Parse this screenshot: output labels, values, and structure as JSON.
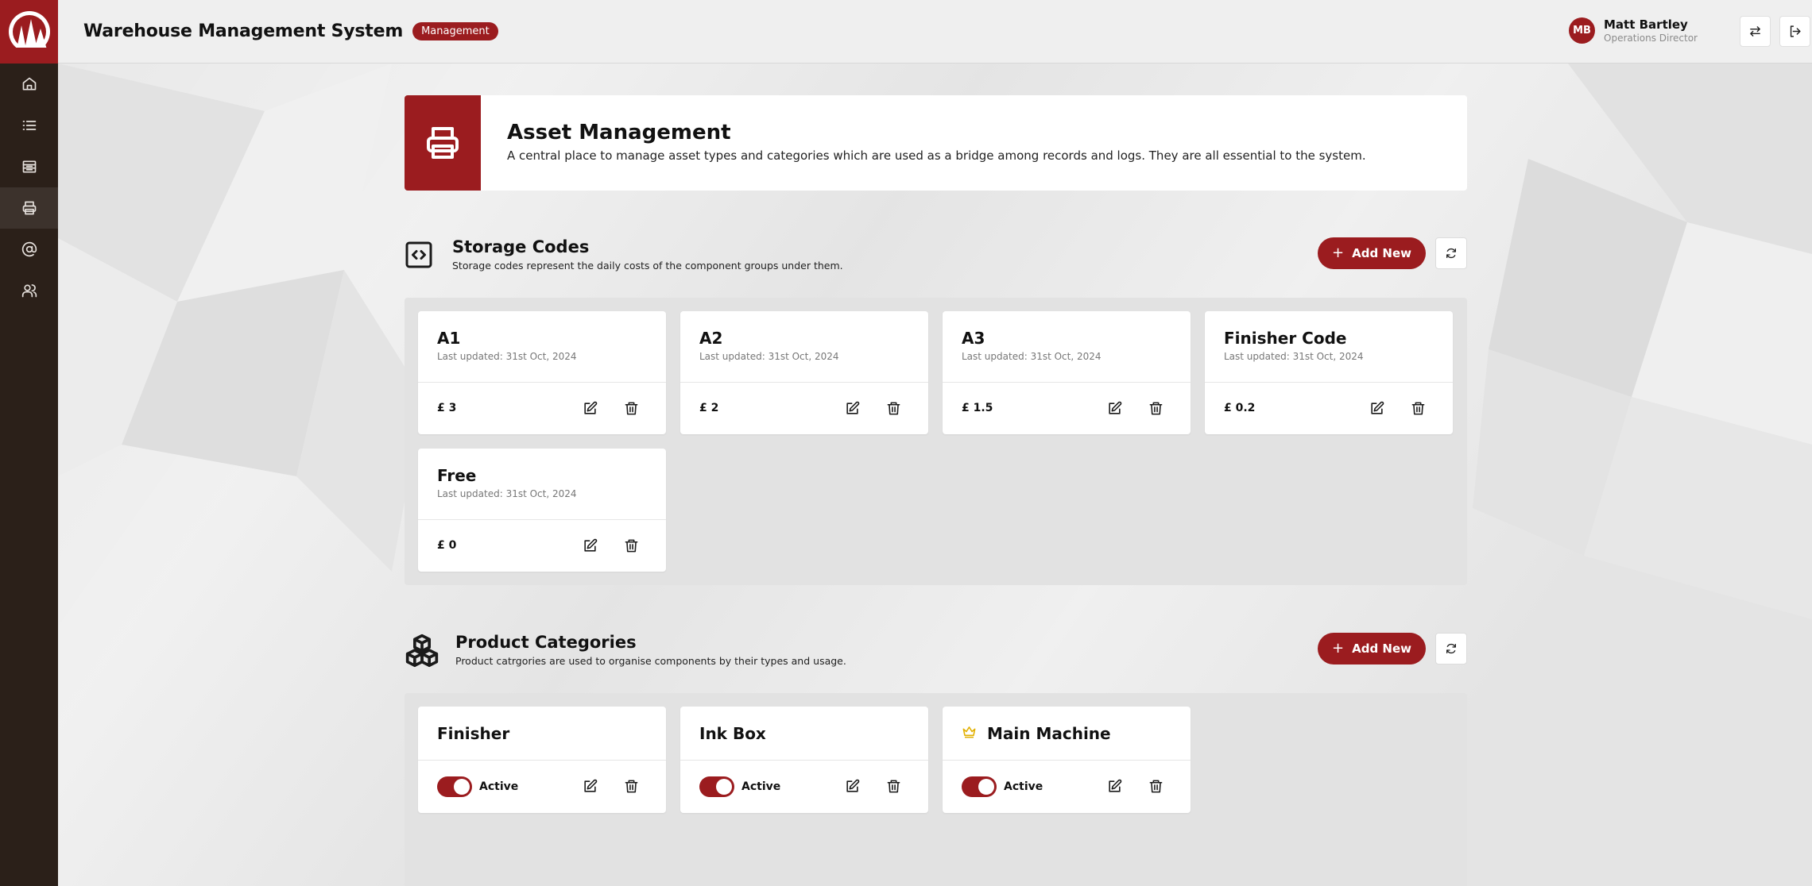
{
  "app": {
    "title": "Warehouse Management System",
    "badge": "Management"
  },
  "user": {
    "initials": "MB",
    "name": "Matt Bartley",
    "role": "Operations Director"
  },
  "sidebar": {
    "items": [
      {
        "icon": "home-icon"
      },
      {
        "icon": "list-icon"
      },
      {
        "icon": "archive-icon"
      },
      {
        "icon": "printer-icon",
        "active": true
      },
      {
        "icon": "at-sign-icon"
      },
      {
        "icon": "users-icon"
      }
    ]
  },
  "hero": {
    "title": "Asset Management",
    "description": "A central place to manage asset types and categories which are used as a bridge among records and logs. They are all essential to the system."
  },
  "storage": {
    "title": "Storage Codes",
    "description": "Storage codes represent the daily costs of the component groups under them.",
    "add_label": "Add New",
    "items": [
      {
        "name": "A1",
        "updated": "Last updated: 31st Oct, 2024",
        "price": "£ 3"
      },
      {
        "name": "A2",
        "updated": "Last updated: 31st Oct, 2024",
        "price": "£ 2"
      },
      {
        "name": "A3",
        "updated": "Last updated: 31st Oct, 2024",
        "price": "£ 1.5"
      },
      {
        "name": "Finisher Code",
        "updated": "Last updated: 31st Oct, 2024",
        "price": "£ 0.2"
      },
      {
        "name": "Free",
        "updated": "Last updated: 31st Oct, 2024",
        "price": "£ 0"
      }
    ]
  },
  "categories": {
    "title": "Product Categories",
    "description": "Product catrgories are used to organise components by their types and usage.",
    "add_label": "Add New",
    "items": [
      {
        "name": "Finisher",
        "status": "Active",
        "active": true
      },
      {
        "name": "Ink Box",
        "status": "Active",
        "active": true
      },
      {
        "name": "Main Machine",
        "status": "Active",
        "active": true,
        "icon": "crown-icon"
      }
    ]
  },
  "colors": {
    "accent": "#9b1c1f",
    "sidebar": "#2b2019",
    "crown": "#e2b000"
  }
}
